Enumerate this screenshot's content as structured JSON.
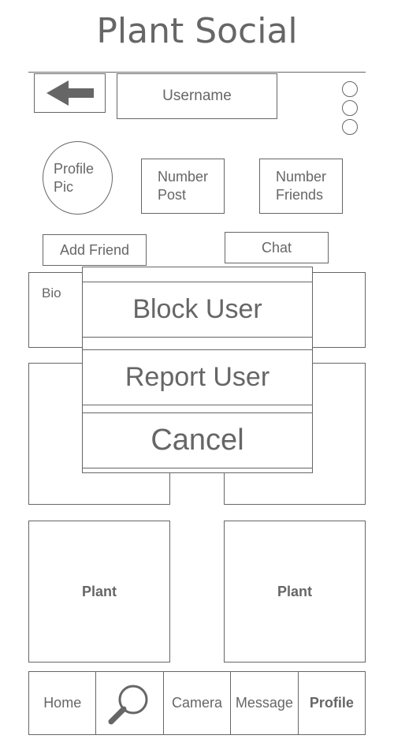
{
  "app": {
    "title": "Plant Social"
  },
  "header": {
    "username": "Username"
  },
  "profile": {
    "pic_label": [
      "Profile",
      "Pic"
    ],
    "post_label": [
      "Number",
      "Post"
    ],
    "friends_label": [
      "Number",
      "Friends"
    ],
    "add_friend": "Add Friend",
    "chat": "Chat",
    "bio": "Bio"
  },
  "grid": {
    "plant_left": "Plant",
    "plant_right": "Plant"
  },
  "nav": {
    "home": "Home",
    "search_icon": "search-icon",
    "camera": "Camera",
    "message": "Message",
    "profile": "Profile"
  },
  "modal": {
    "block": "Block User",
    "report": "Report User",
    "cancel": "Cancel"
  }
}
